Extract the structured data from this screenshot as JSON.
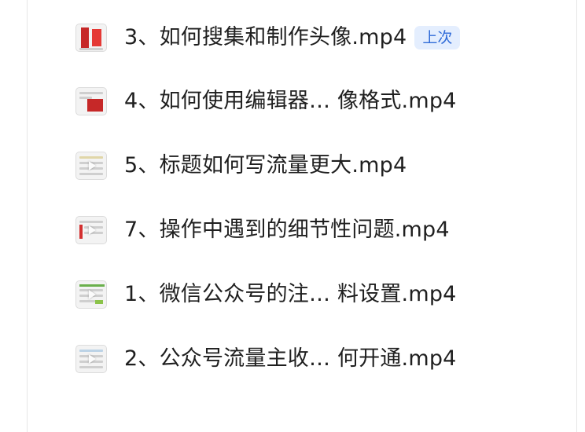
{
  "file_list": {
    "items": [
      {
        "name": "3、如何搜集和制作头像.mp4",
        "badge": "上次",
        "thumb": "red-phone-thumbnail"
      },
      {
        "name": "4、如何使用编辑器…  像格式.mp4",
        "badge": null,
        "thumb": "red-editor-thumbnail"
      },
      {
        "name": "5、标题如何写流量更大.mp4",
        "badge": null,
        "thumb": "screen-thumbnail"
      },
      {
        "name": "7、操作中遇到的细节性问题.mp4",
        "badge": null,
        "thumb": "screen-thumbnail"
      },
      {
        "name": "1、微信公众号的注…  料设置.mp4",
        "badge": null,
        "thumb": "green-screen-thumbnail"
      },
      {
        "name": "2、公众号流量主收…  何开通.mp4",
        "badge": null,
        "thumb": "screen-thumbnail"
      }
    ]
  },
  "colors": {
    "text": "#1f1f1f",
    "badge_bg": "#e4eefe",
    "badge_text": "#2f6bd8",
    "divider": "#e6e6e6"
  }
}
